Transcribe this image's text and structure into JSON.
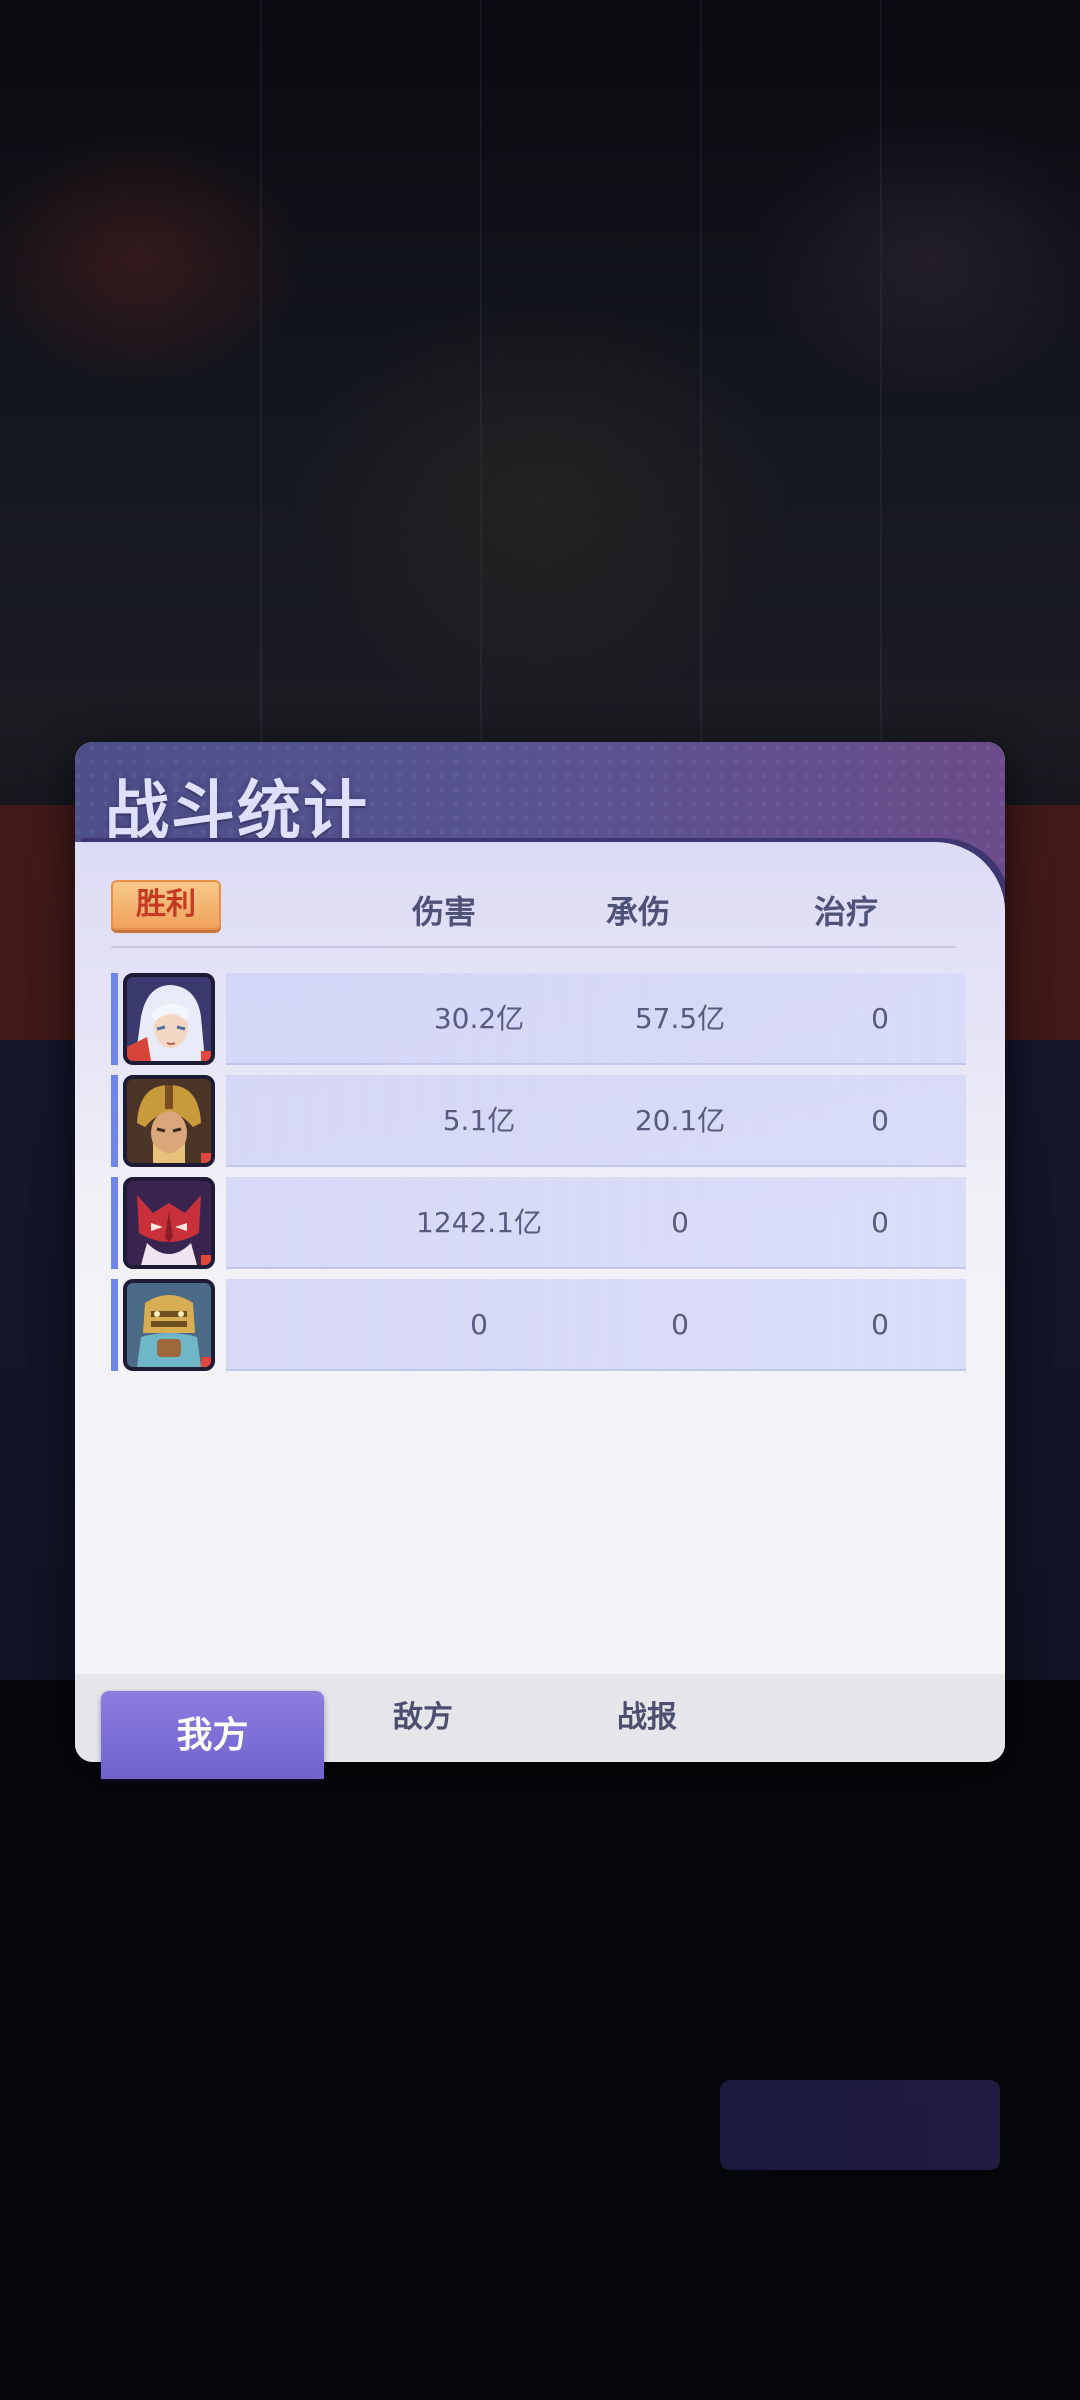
{
  "panel": {
    "title": "战斗统计",
    "result": "胜利",
    "columns": {
      "damage": "伤害",
      "taken": "承伤",
      "heal": "治疗"
    }
  },
  "rows": [
    {
      "hero": "white-haired-hero-icon",
      "damage": "30.2亿",
      "taken": "57.5亿",
      "heal": "0"
    },
    {
      "hero": "golden-helm-hero-icon",
      "damage": "5.1亿",
      "taken": "20.1亿",
      "heal": "0"
    },
    {
      "hero": "red-mask-hero-icon",
      "damage": "1242.1亿",
      "taken": "0",
      "heal": "0"
    },
    {
      "hero": "golden-golem-hero-icon",
      "damage": "0",
      "taken": "0",
      "heal": "0"
    }
  ],
  "tabs": {
    "ours": "我方",
    "enemy": "敌方",
    "report": "战报"
  },
  "colors": {
    "accent": "#6f86e6",
    "header": "#575491",
    "active_tab": "#7d6fd6",
    "badge": "#f0a25c"
  }
}
